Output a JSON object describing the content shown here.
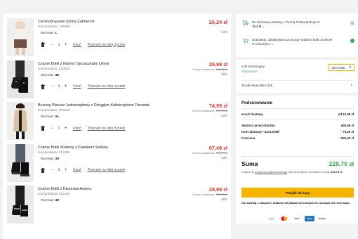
{
  "cart": {
    "items": [
      {
        "name": "Ciemnobrązowe Szorty Cahrienne",
        "code_label": "Kod produktu:",
        "code": "140295",
        "size_label": "Rozmiar:",
        "size": "L",
        "price": "26,24 zł",
        "old_price_label": "",
        "old_price": "",
        "discount": "-81%",
        "qty": "1"
      },
      {
        "name": "Czarne Botki z Nitami i Sprzączkami Lifone",
        "code_label": "Kod produktu:",
        "code": "210630",
        "size_label": "Rozmiar:",
        "size": "38",
        "price": "29,99 zł",
        "old_price_label": "Cena początkowa:",
        "old_price": "149,99 zł",
        "discount": "-80%",
        "qty": "1"
      },
      {
        "name": "Beżowy Płaszcz Jednorzędowy z Okrągłym Kołnierzykiem Theseda",
        "code_label": "Kod produktu:",
        "code": "207832",
        "size_label": "Rozmiar:",
        "size": "XL",
        "price": "74,99 zł",
        "old_price_label": "Cena początkowa:",
        "old_price": "199,99 zł",
        "discount": "-63%",
        "qty": "1"
      },
      {
        "name": "Czarne Botki Workery z Ćwiekami Stefana",
        "code_label": "Kod produktu:",
        "code": "211256",
        "size_label": "Rozmiar:",
        "size": "39",
        "price": "67,49 zł",
        "old_price_label": "Cena początkowa:",
        "old_price": "189,99 zł",
        "discount": "-64%",
        "qty": "1"
      },
      {
        "name": "Czarne Botki z Klamrami Asoora",
        "code_label": "Kod produktu:",
        "code": "211265",
        "size_label": "Rozmiar:",
        "size": "38",
        "price": "29,99 zł",
        "old_price_label": "Cena początkowa:",
        "old_price": "149,99 zł",
        "discount": "-80%",
        "qty": "1"
      }
    ],
    "remove_label": "Usuń",
    "wishlist_label": "Przenieś na listę życzeń",
    "qty_minus": "−",
    "qty_plus": "+"
  },
  "shipping": {
    "line1": "Do darmowej dostawy z Pocztą Polską brakuje Ci",
    "line1_amount": "71,3 zł",
    "line2": "Gratulacje, odblokowano promocję! Odbierz botki za 39,99",
    "line2_b": "zł w koszyku!"
  },
  "promo": {
    "label": "Kod promocyjny",
    "status": "Aktywowano",
    "code": "SZALONE",
    "club": "Środki Born2be Club"
  },
  "summary": {
    "title": "Podsumowanie",
    "delivery_label": "Koszt dostawy",
    "delivery_value": "od 10,99 zł",
    "before_label": "Wartość przed obniżką",
    "before_value": "829,95 zł",
    "code_label": "Kod rabatowy \"SZALONE\"",
    "code_value": "- 76,25 zł",
    "promo_label": "Przecena",
    "promo_value": "- 525,00 zł",
    "total_label": "Suma",
    "total_value": "228,70 zł",
    "note_a": "Dołącz do",
    "note_link": "programu lojalnościowego",
    "note_b": "aby otrzymać te produkty w cenie",
    "note_price": "224,70 zł",
    "cta": "Przejdź do kasy",
    "warning": "Nie zwlekaj z zakupem, dodanie artykułów do koszyka nie oznacza ich rezerwacji.",
    "payments": [
      "hypay",
      "Mastercard",
      "VISA",
      "Przelewy24",
      "PayPal"
    ]
  },
  "colors": {
    "price": "#e23b2e",
    "accent": "#f5b400",
    "green": "#3aa757"
  }
}
